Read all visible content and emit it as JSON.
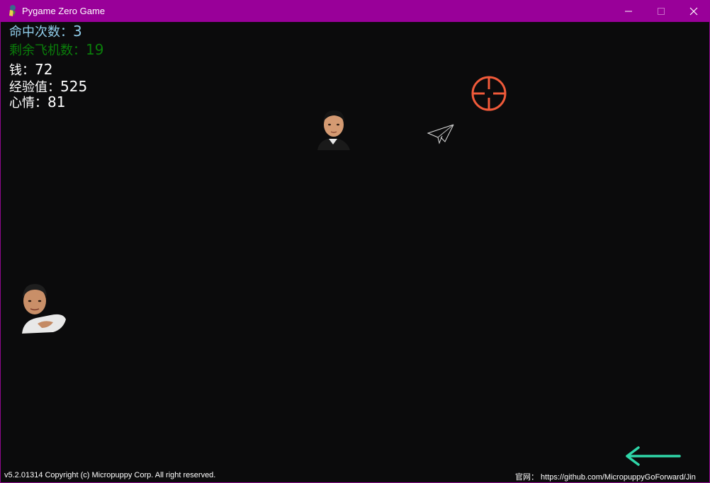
{
  "window": {
    "title": "Pygame Zero Game",
    "title_bar_color": "#990099"
  },
  "hud": {
    "hits_label": "命中次数：",
    "hits_value": "3",
    "planes_left_label": "剩余飞机数：",
    "planes_left_value": "19",
    "money_label": "钱：",
    "money_value": "72",
    "exp_label": "经验值：",
    "exp_value": "525",
    "mood_label": "心情：",
    "mood_value": "81"
  },
  "sprites": {
    "crosshair": "crosshair-icon",
    "plane": "paper-plane-icon",
    "player_face_top": "face-sprite",
    "player_face_left": "face-sprite",
    "back": "back-arrow-icon"
  },
  "footer": {
    "copyright": "v5.2.01314 Copyright (c) Micropuppy Corp. All right reserved.",
    "website": "官网：  https://github.com/MicropuppyGoForward/Jin"
  },
  "colors": {
    "background": "#0b0b0c",
    "crosshair": "#f05a3a",
    "arrow": "#2fd6a8",
    "hits_text": "#8fcbe8",
    "planes_text": "#0a7d0a"
  }
}
